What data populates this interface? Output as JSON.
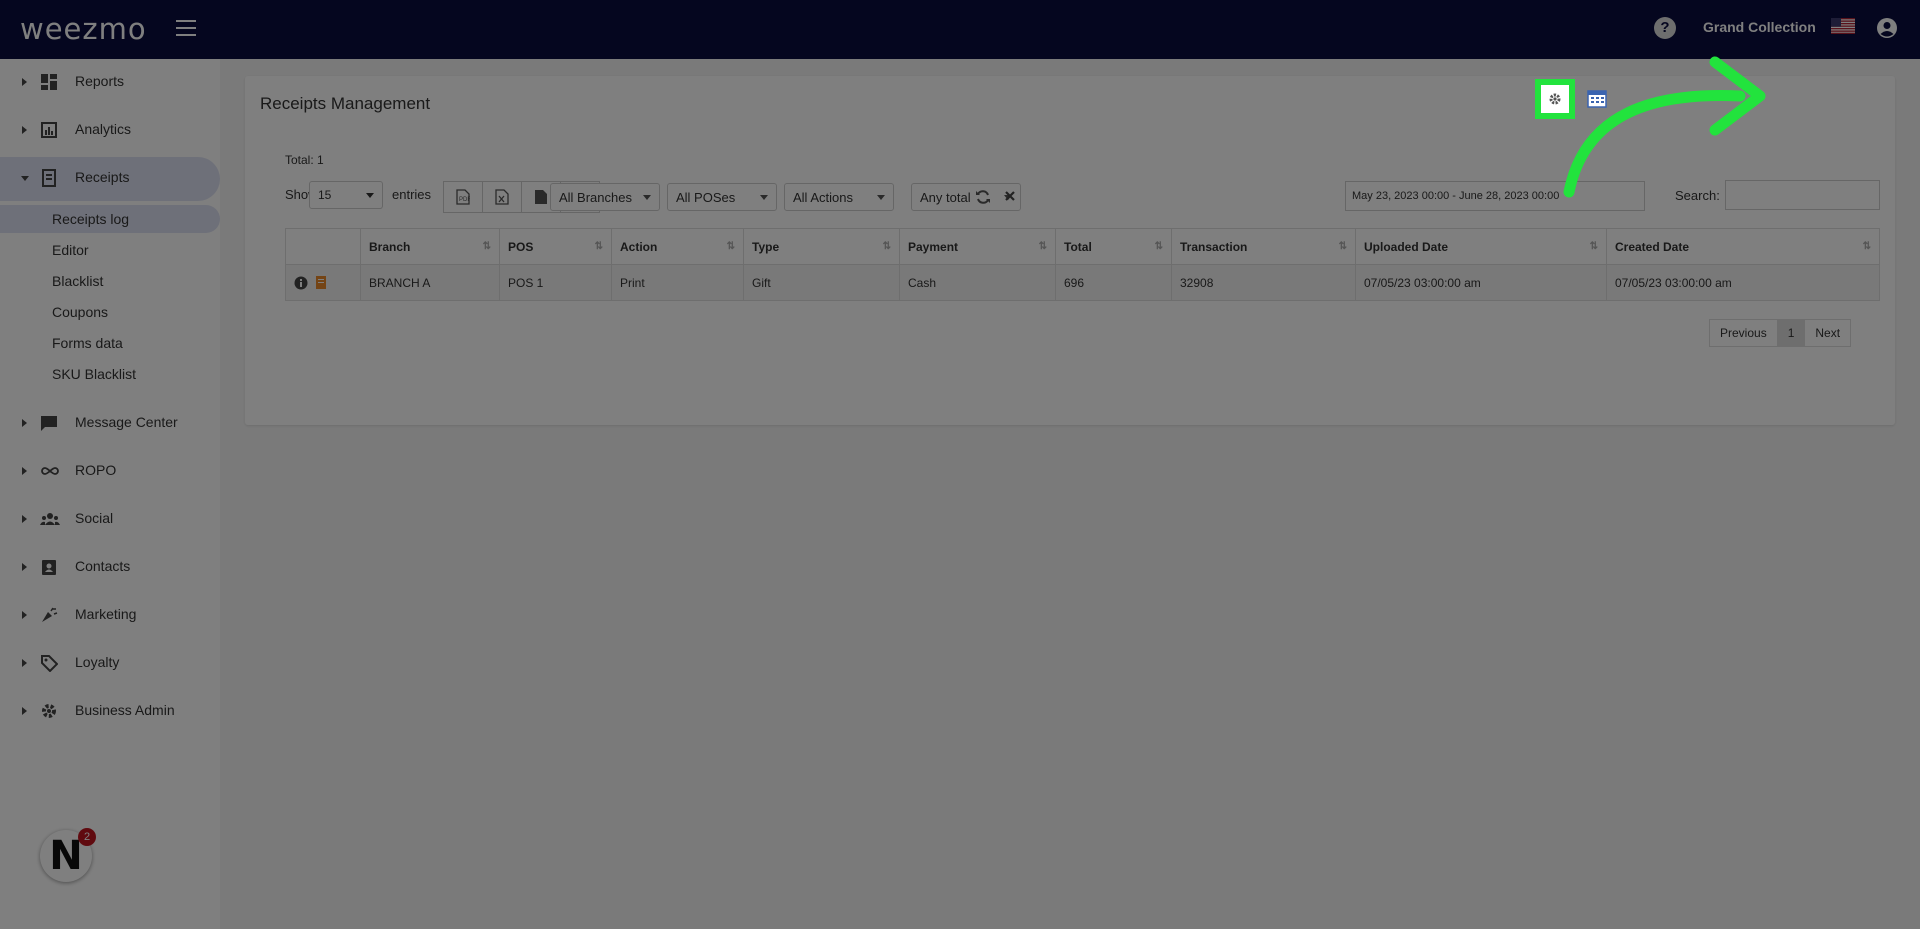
{
  "header": {
    "logo": "weezmo",
    "account_name": "Grand Collection"
  },
  "sidebar": {
    "items": [
      {
        "label": "Reports",
        "icon": "dashboard-icon"
      },
      {
        "label": "Analytics",
        "icon": "analytics-icon"
      },
      {
        "label": "Receipts",
        "icon": "receipt-icon",
        "open": true
      },
      {
        "label": "Message Center",
        "icon": "chat-icon"
      },
      {
        "label": "ROPO",
        "icon": "infinity-icon"
      },
      {
        "label": "Social",
        "icon": "people-icon"
      },
      {
        "label": "Contacts",
        "icon": "contacts-icon"
      },
      {
        "label": "Marketing",
        "icon": "megaphone-icon"
      },
      {
        "label": "Loyalty",
        "icon": "tag-icon"
      },
      {
        "label": "Business Admin",
        "icon": "gear-icon"
      }
    ],
    "subitems": [
      "Receipts log",
      "Editor",
      "Blacklist",
      "Coupons",
      "Forms data",
      "SKU Blacklist"
    ],
    "notification_count": "2"
  },
  "main": {
    "title": "Receipts Management",
    "total_label": "Total: 1",
    "show_label": "Show",
    "entries_value": "15",
    "entries_label": "entries",
    "filters": {
      "branches": "All Branches",
      "poses": "All POSes",
      "actions": "All Actions",
      "total": "Any total"
    },
    "date_range": "May 23, 2023 00:00 - June 28, 2023 00:00",
    "search_label": "Search:",
    "table": {
      "headers": [
        "Branch",
        "POS",
        "Action",
        "Type",
        "Payment",
        "Total",
        "Transaction",
        "Uploaded Date",
        "Created Date"
      ],
      "rows": [
        [
          "BRANCH A",
          "POS 1",
          "Print",
          "Gift",
          "Cash",
          "696",
          "32908",
          "07/05/23 03:00:00 am",
          "07/05/23 03:00:00 am"
        ]
      ]
    },
    "pager": {
      "prev": "Previous",
      "page": "1",
      "next": "Next"
    }
  },
  "colors": {
    "topbar": "#0b0c3e",
    "highlight": "#22e33d",
    "active_menu": "#dde1f2"
  }
}
